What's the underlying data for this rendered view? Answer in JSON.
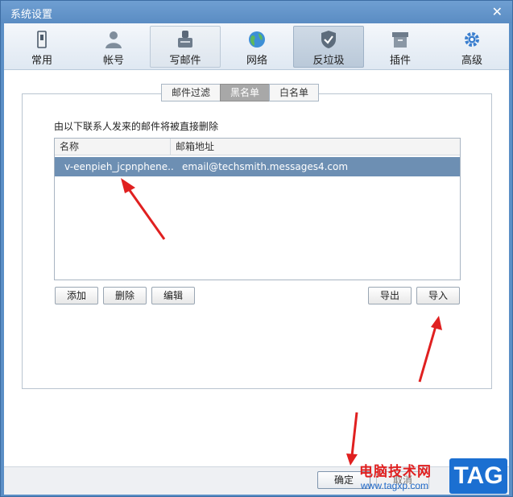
{
  "window": {
    "title": "系统设置",
    "close_glyph": "✕"
  },
  "toolbar": {
    "items": [
      {
        "label": "常用",
        "icon": "general-icon"
      },
      {
        "label": "帐号",
        "icon": "account-icon"
      },
      {
        "label": "写邮件",
        "icon": "compose-icon"
      },
      {
        "label": "网络",
        "icon": "network-icon"
      },
      {
        "label": "反垃圾",
        "icon": "antispam-icon"
      },
      {
        "label": "插件",
        "icon": "plugin-icon"
      },
      {
        "label": "高级",
        "icon": "advanced-icon"
      }
    ],
    "selected": "反垃圾"
  },
  "subtabs": {
    "items": [
      "邮件过滤",
      "黑名单",
      "白名单"
    ],
    "active": "黑名单"
  },
  "blacklist": {
    "description": "由以下联系人发来的邮件将被直接删除",
    "columns": [
      "名称",
      "邮箱地址"
    ],
    "rows": [
      {
        "name": "v-eenpieh_jcpnphene...",
        "email": "email@techsmith.messages4.com"
      }
    ]
  },
  "actions": {
    "add": "添加",
    "delete": "删除",
    "edit": "编辑",
    "export": "导出",
    "import": "导入"
  },
  "footer": {
    "ok": "确定",
    "cancel": "取消"
  },
  "watermark": {
    "text": "电脑技术网",
    "url": "www.tagxp.com",
    "tag": "TAG"
  },
  "colors": {
    "title_bar": "#5b8fc6",
    "selected_row": "#6d8fb3",
    "annotation_arrow": "#e02020",
    "watermark_tag": "#1b6fd1"
  }
}
